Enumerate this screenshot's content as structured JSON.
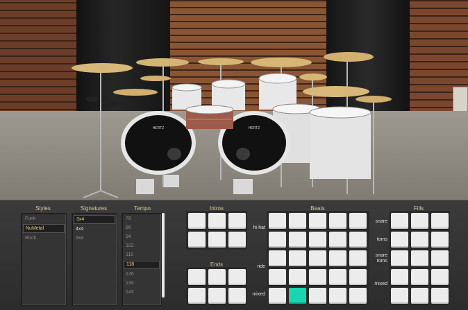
{
  "panel": {
    "styles": {
      "title": "Styles",
      "items": [
        "Funk",
        "NuMetal",
        "Rock"
      ],
      "selected": "NuMetal"
    },
    "signatures": {
      "title": "Signatures",
      "items": [
        "3x4",
        "4x4",
        "6x4"
      ],
      "selected": "3x4"
    },
    "tempo": {
      "title": "Tempo",
      "items": [
        "78",
        "86",
        "94",
        "102",
        "110",
        "118",
        "126",
        "134",
        "143"
      ],
      "selected": "118"
    },
    "intros": {
      "title": "Intros"
    },
    "ends": {
      "title": "Ends"
    },
    "beats": {
      "title": "Beats",
      "rows": [
        "hi-hat",
        "",
        "ride",
        "mixed"
      ]
    },
    "fills": {
      "title": "Fills",
      "rows": [
        "snare",
        "toms",
        "snare toms",
        "mixed"
      ]
    }
  },
  "colors": {
    "accent_active_pad": "#19d6b0",
    "selected_text": "#e6d07a",
    "title_text": "#d6c89e"
  },
  "kit": {
    "brand_label": "HERTZ"
  }
}
